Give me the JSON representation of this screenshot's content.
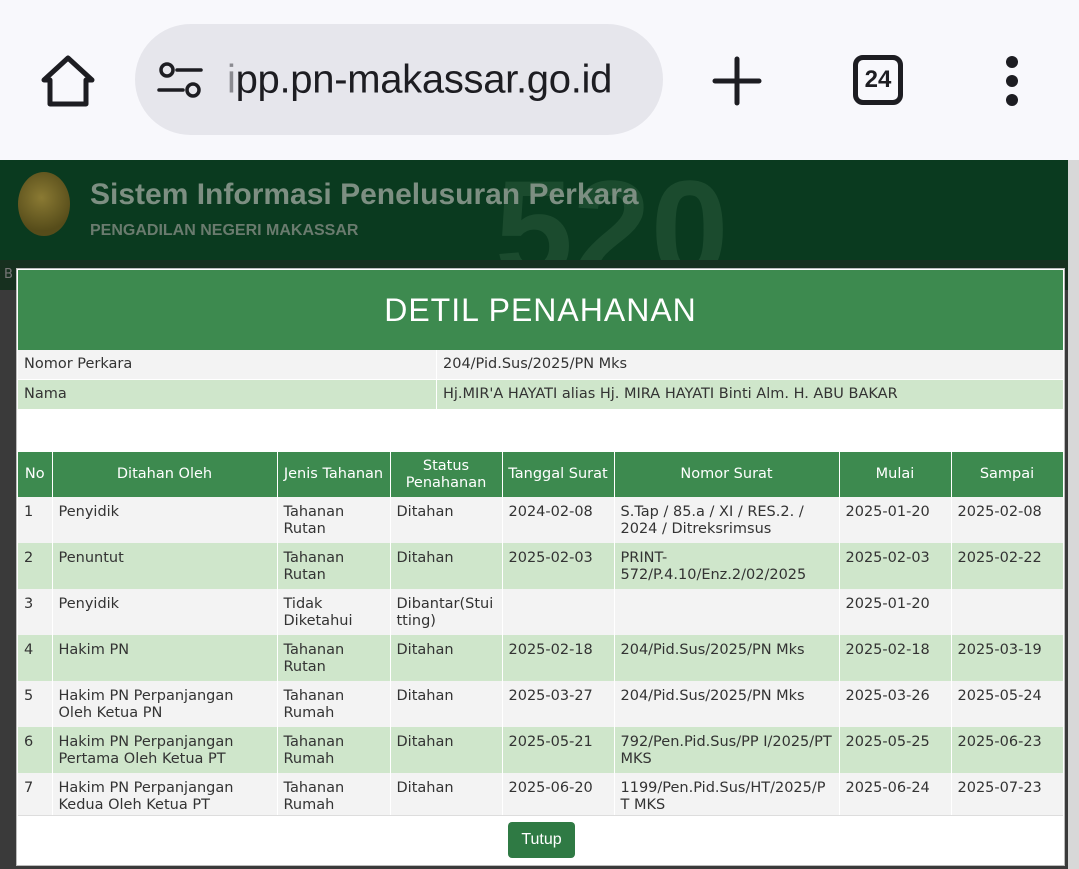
{
  "browser": {
    "url_faded": "i",
    "url_main": "pp.pn-makassar.go.id",
    "tab_count": "24"
  },
  "site": {
    "title": "Sistem Informasi Penelusuran Perkara",
    "subtitle": "PENGADILAN NEGERI MAKASSAR",
    "bg_number": "520",
    "nav_fragment": "B"
  },
  "modal": {
    "title": "DETIL PENAHANAN",
    "nomor_label": "Nomor Perkara",
    "nomor_value": "204/Pid.Sus/2025/PN Mks",
    "nama_label": "Nama",
    "nama_value": "Hj.MIR'A HAYATI alias Hj. MIRA HAYATI Binti Alm. H. ABU BAKAR",
    "close_label": "Tutup"
  },
  "table": {
    "headers": [
      "No",
      "Ditahan Oleh",
      "Jenis Tahanan",
      "Status Penahanan",
      "Tanggal Surat",
      "Nomor Surat",
      "Mulai",
      "Sampai"
    ],
    "rows": [
      [
        "1",
        "Penyidik",
        "Tahanan Rutan",
        "Ditahan",
        "2024-02-08",
        "S.Tap / 85.a / XI / RES.2. / 2024 / Ditreksrimsus",
        "2025-01-20",
        "2025-02-08"
      ],
      [
        "2",
        "Penuntut",
        "Tahanan Rutan",
        "Ditahan",
        "2025-02-03",
        "PRINT-572/P.4.10/Enz.2/02/2025",
        "2025-02-03",
        "2025-02-22"
      ],
      [
        "3",
        "Penyidik",
        "Tidak Diketahui",
        "Dibantar(Stuitting)",
        "",
        "",
        "2025-01-20",
        ""
      ],
      [
        "4",
        "Hakim PN",
        "Tahanan Rutan",
        "Ditahan",
        "2025-02-18",
        "204/Pid.Sus/2025/PN Mks",
        "2025-02-18",
        "2025-03-19"
      ],
      [
        "5",
        "Hakim PN Perpanjangan Oleh Ketua PN",
        "Tahanan Rumah",
        "Ditahan",
        "2025-03-27",
        "204/Pid.Sus/2025/PN Mks",
        "2025-03-26",
        "2025-05-24"
      ],
      [
        "6",
        "Hakim PN Perpanjangan Pertama Oleh Ketua PT",
        "Tahanan Rumah",
        "Ditahan",
        "2025-05-21",
        "792/Pen.Pid.Sus/PP I/2025/PT MKS",
        "2025-05-25",
        "2025-06-23"
      ],
      [
        "7",
        "Hakim PN Perpanjangan Kedua Oleh Ketua PT",
        "Tahanan Rumah",
        "Ditahan",
        "2025-06-20",
        "1199/Pen.Pid.Sus/HT/2025/PT MKS",
        "2025-06-24",
        "2025-07-23"
      ]
    ]
  }
}
